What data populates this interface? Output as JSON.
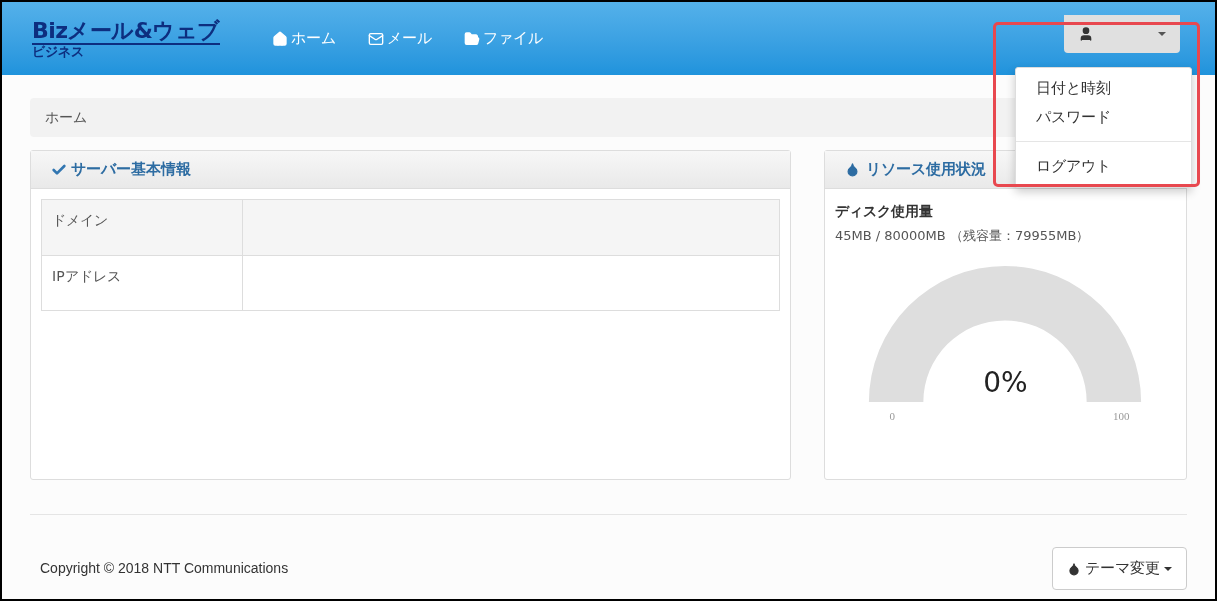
{
  "header": {
    "logo": {
      "main": "Bizメール&ウェブ",
      "sub": "ビジネス"
    },
    "nav": [
      {
        "label": "ホーム"
      },
      {
        "label": "メール"
      },
      {
        "label": "ファイル"
      }
    ],
    "user_menu": {
      "expanded": true,
      "items": [
        {
          "kind": "item",
          "label": "日付と時刻"
        },
        {
          "kind": "item",
          "label": "パスワード"
        },
        {
          "kind": "divider"
        },
        {
          "kind": "item",
          "label": "ログアウト"
        }
      ]
    }
  },
  "breadcrumb": [
    "ホーム"
  ],
  "server_panel": {
    "title": "サーバー基本情報",
    "rows": [
      {
        "label": "ドメイン"
      },
      {
        "label": "IPアドレス"
      }
    ]
  },
  "resource_panel": {
    "title": "リソース使用状況",
    "disk": {
      "title": "ディスク使用量",
      "usage": "45MB / 80000MB （残容量：79955MB）",
      "gauge": {
        "reading": "0%",
        "min": "0",
        "max": "100"
      }
    }
  },
  "footer": {
    "copyright": "Copyright © 2018 NTT Communications",
    "theme_button": "テーマ変更"
  }
}
